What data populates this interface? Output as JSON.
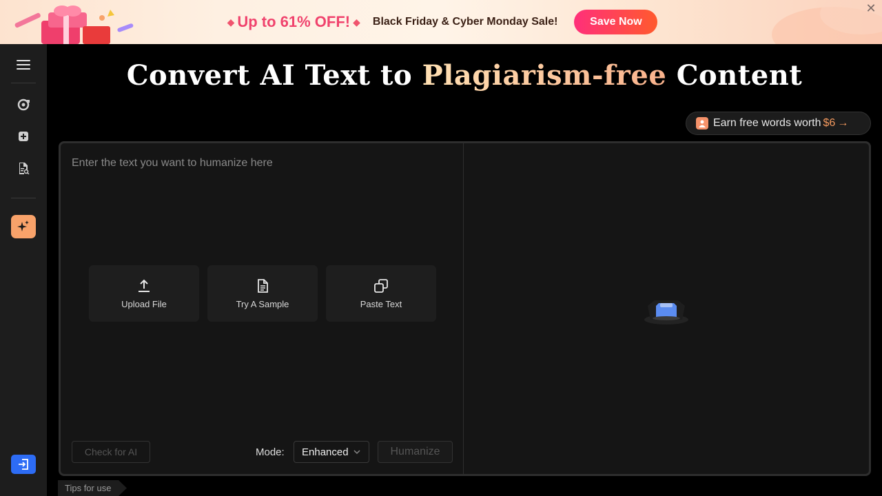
{
  "banner": {
    "discount": "Up to 61% OFF!",
    "sale_text": "Black Friday & Cyber Monday Sale!",
    "cta": "Save Now",
    "close_icon": "close-icon"
  },
  "sidebar": {
    "items": [
      {
        "name": "menu",
        "icon": "menu-icon"
      },
      {
        "name": "rewrite",
        "icon": "refresh-icon"
      },
      {
        "name": "add",
        "icon": "plus-box-icon"
      },
      {
        "name": "detect",
        "icon": "document-search-icon"
      },
      {
        "name": "ai-humanizer",
        "icon": "sparkle-icon"
      },
      {
        "name": "login",
        "icon": "login-icon"
      }
    ]
  },
  "title": {
    "part1": "Convert AI Text to",
    "highlight": "Plagiarism-free",
    "part2": "Content"
  },
  "earn": {
    "label": "Earn free words worth",
    "amount": "$6",
    "arrow": "→"
  },
  "editor": {
    "placeholder": "Enter the text you want to humanize here",
    "actions": [
      {
        "label": "Upload File",
        "icon": "upload-icon"
      },
      {
        "label": "Try A Sample",
        "icon": "document-icon"
      },
      {
        "label": "Paste Text",
        "icon": "copy-icon"
      }
    ],
    "check_button": "Check for AI",
    "mode_label": "Mode:",
    "mode_value": "Enhanced",
    "humanize_button": "Humanize"
  },
  "tips": "Tips for use",
  "colors": {
    "accent_orange": "#f8a26a",
    "accent_blue": "#2d6cf5",
    "cta_gradient_start": "#ff2f7a",
    "cta_gradient_end": "#ff5a2e"
  }
}
